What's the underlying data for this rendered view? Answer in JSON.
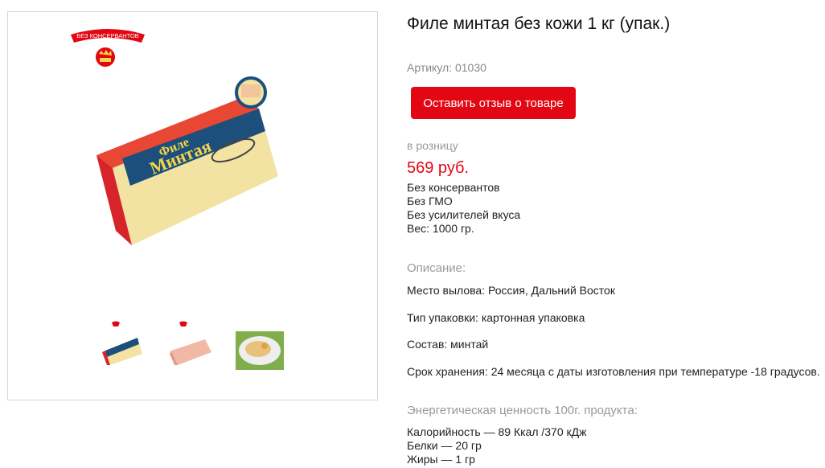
{
  "product": {
    "title": "Филе минтая без кожи 1 кг (упак.)",
    "sku": "Артикул: 01030",
    "review_button": "Оставить отзыв о товаре",
    "retail_label": "в розницу",
    "price": "569 руб.",
    "features": [
      "Без консервантов",
      "Без ГМО",
      "Без усилителей вкуса",
      "Вес: 1000 гр."
    ],
    "description_label": "Описание:",
    "description": [
      "Место вылова: Россия, Дальний Восток",
      "Тип упаковки: картонная упаковка",
      "Состав: минтай",
      "Срок хранения: 24 месяца с даты изготовления при температуре -18 градусов."
    ],
    "energy_label": "Энергетическая ценность 100г. продукта:",
    "nutrition": [
      "Калорийность — 89 Ккал /370 кДж",
      "Белки — 20 гр",
      "Жиры — 1 гр"
    ]
  },
  "gallery": {
    "badge_text": "БЕЗ КОНСЕРВАНТОВ",
    "box_text_line1": "Филе",
    "box_text_line2": "Минтая",
    "thumbnails": [
      "package-box-thumbnail",
      "fish-fillet-thumbnail",
      "cooked-dish-thumbnail"
    ]
  },
  "colors": {
    "accent": "#e30613",
    "muted": "#999999",
    "box_blue": "#1d4f7c",
    "box_yellow": "#f3e3a3"
  }
}
